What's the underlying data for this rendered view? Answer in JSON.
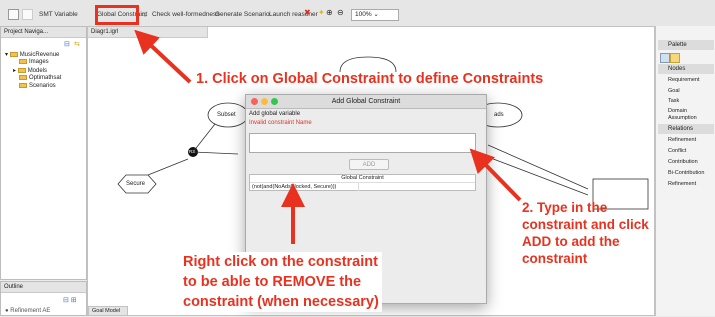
{
  "toolbar": {
    "smt_variable": "SMT Variable",
    "global_constraint": "Global Constraint",
    "check_wellformedness": "Check well-formedness",
    "generate_scenario": "Generate Scenario",
    "launch_reasoner": "Launch reasoner",
    "zoom_value": "100%"
  },
  "left": {
    "navigator_tab": "Project Naviga...",
    "tree": [
      {
        "label": "MusicRevenue"
      },
      {
        "label": "Images"
      },
      {
        "label": "Models"
      },
      {
        "label": "Optimathsat"
      },
      {
        "label": "Scenarios"
      }
    ],
    "outline_tab": "Outline",
    "bottom_item": "Refinement AE"
  },
  "editor": {
    "tab": "Diagr1.igrl",
    "bottom_tab": "Goal Model",
    "nodes": {
      "subset_label": "Subset",
      "ads_label": "ads",
      "refinement_label": "R3",
      "secure_label": "Secure"
    }
  },
  "palette": {
    "title": "Palette",
    "nodes_header": "Nodes",
    "nodes": [
      "Requirement",
      "Goal",
      "Task",
      "Domain Assumption"
    ],
    "relations_header": "Relations",
    "relations": [
      "Refinement",
      "Conflict",
      "Contribution",
      "Bi-Contribution",
      "Refinement"
    ]
  },
  "dialog": {
    "title": "Add Global Constraint",
    "heading": "Add global variable",
    "error": "Invalid constraint Name",
    "input_value": "",
    "add_button": "ADD",
    "table_header": "Global Constraint",
    "table_rows": [
      "(not(and(NoAdsBlocked, Secure)))"
    ]
  },
  "annotations": {
    "step1": "1. Click on Global Constraint to define Constraints",
    "step2_lines": [
      "2. Type in the",
      "constraint and click",
      "ADD to add the",
      "constraint"
    ],
    "step3_lines": [
      "Right click on the constraint",
      "to be able to REMOVE the",
      "constraint (when necessary)"
    ]
  },
  "colors": {
    "annotation_red": "#e8321f",
    "error_red": "#d9342b"
  }
}
